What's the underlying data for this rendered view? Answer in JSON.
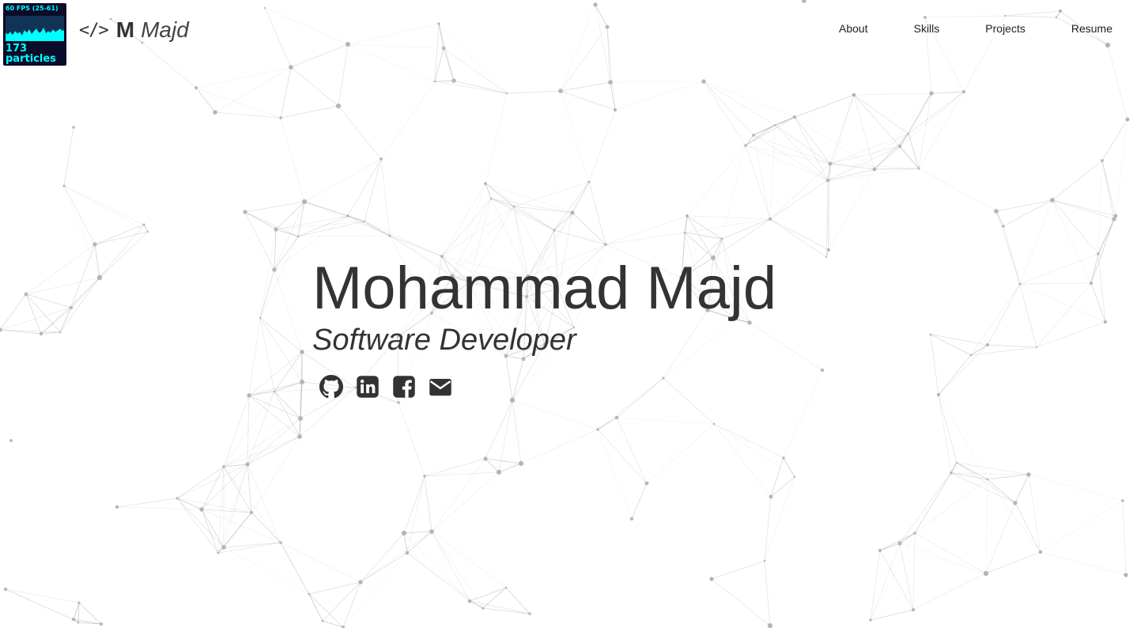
{
  "stats": {
    "fps_label": "60 FPS (25-61)",
    "particle_count": "173",
    "particle_label": "particles"
  },
  "brand": {
    "icon": "code-icon",
    "code_glyph": "</>",
    "initial": "M",
    "name": "Majd"
  },
  "nav": {
    "items": [
      "About",
      "Skills",
      "Projects",
      "Resume"
    ]
  },
  "hero": {
    "name": "Mohammad Majd",
    "role": "Software Developer"
  },
  "socials": [
    {
      "icon": "github-icon"
    },
    {
      "icon": "linkedin-icon"
    },
    {
      "icon": "facebook-icon"
    },
    {
      "icon": "email-icon"
    }
  ],
  "colors": {
    "text": "#333333",
    "stats_bg": "#0b0b2a",
    "stats_accent": "#00ffff",
    "network": "#9a9a9a"
  }
}
